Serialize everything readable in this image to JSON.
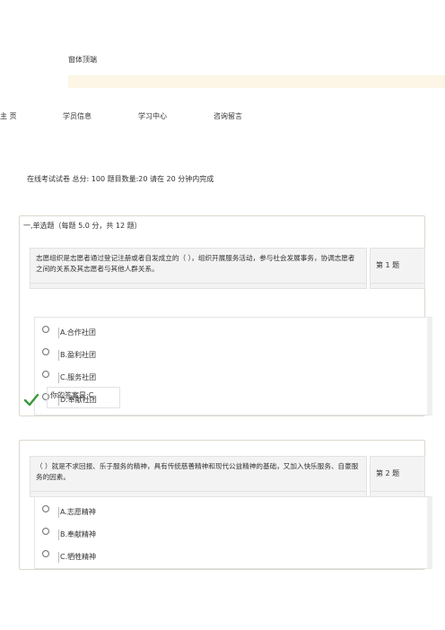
{
  "header": {
    "title": "窗体顶端"
  },
  "nav": {
    "items": [
      "主 页",
      "学员信息",
      "学习中心",
      "咨询留言"
    ]
  },
  "exam": {
    "info": "在线考试试卷  总分: 100  题目数量:20  请在  20  分钟内完成"
  },
  "section1": {
    "heading": "一,单选题（每题 5.0 分，共 12 题）"
  },
  "questions": [
    {
      "text": "志愿组织是志愿者通过登记注册或者自发成立的（ ），组织开展服务活动，参与社会发展事务，协调志愿者之间的关系及其志愿者与其他人群关系。",
      "number": "第 1 题",
      "options": [
        {
          "letter": "A.",
          "text": "合作社团"
        },
        {
          "letter": "B.",
          "text": "盈利社团"
        },
        {
          "letter": "C.",
          "text": "服务社团"
        },
        {
          "letter": "D.",
          "text": "奉献社团"
        }
      ],
      "answer": "你的答案是:C"
    },
    {
      "text": "（ ）就是不求回报、乐于服务的精神，具有传统慈善精神和现代公益精神的基础，又加入快乐服务、自豪服务的因素。",
      "number": "第 2 题",
      "options": [
        {
          "letter": "A.",
          "text": "志愿精神"
        },
        {
          "letter": "B.",
          "text": "奉献精神"
        },
        {
          "letter": "C.",
          "text": "牺牲精神"
        }
      ]
    }
  ],
  "colors": {
    "top_bar": "#fdf6e6",
    "check": "#3a9a3a",
    "panel_bg": "#f3f3f3"
  }
}
